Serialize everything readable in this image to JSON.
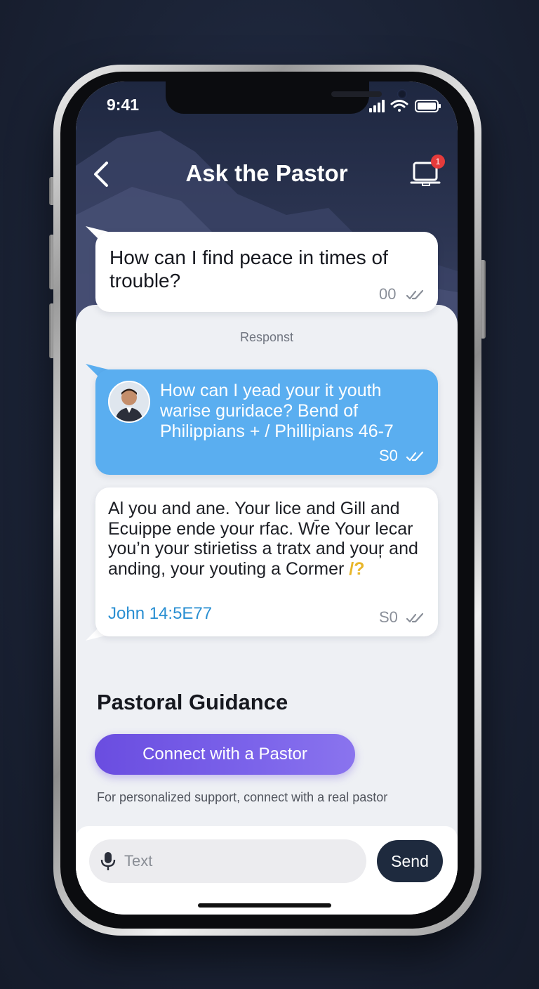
{
  "status_bar": {
    "time": "9:41",
    "signal_icon": "signal-bars-icon",
    "wifi_icon": "wifi-icon",
    "battery_icon": "battery-icon"
  },
  "header": {
    "title": "Ask the Pastor",
    "back_icon": "chevron-left-icon",
    "device_icon": "laptop-icon",
    "notification_count": "1"
  },
  "messages": [
    {
      "text": "How can I find peace in times of trouble?",
      "meta": "00",
      "read_icon": "double-check-icon"
    },
    {
      "text": "How can I yead your it youth warise guridace? Bend of Philippians + / Phillipians 46-7",
      "meta": "S0",
      "read_icon": "double-check-icon"
    },
    {
      "text": "Al you and ane. Your lice and Gill and Ecuippe ende your rfac. Wr̄e Your lecar you’n your stirietiss a tratx and your̦ and anding, your youting a Cormer",
      "question_mark": "/?",
      "verse": "John 14:5E77",
      "meta": "S0",
      "read_icon": "double-check-icon"
    }
  ],
  "response_label": "Responst",
  "pastoral": {
    "title": "Pastoral Guidance",
    "connect_label": "Connect with a Pastor",
    "note": "For personalized support, connect with a real pastor"
  },
  "composer": {
    "placeholder": "Text",
    "mic_icon": "microphone-icon",
    "send_label": "Send"
  },
  "colors": {
    "accent_blue": "#5aaef0",
    "accent_purple": "#6a4de0",
    "send_dark": "#1e2a3e",
    "badge_red": "#e53b3b"
  }
}
